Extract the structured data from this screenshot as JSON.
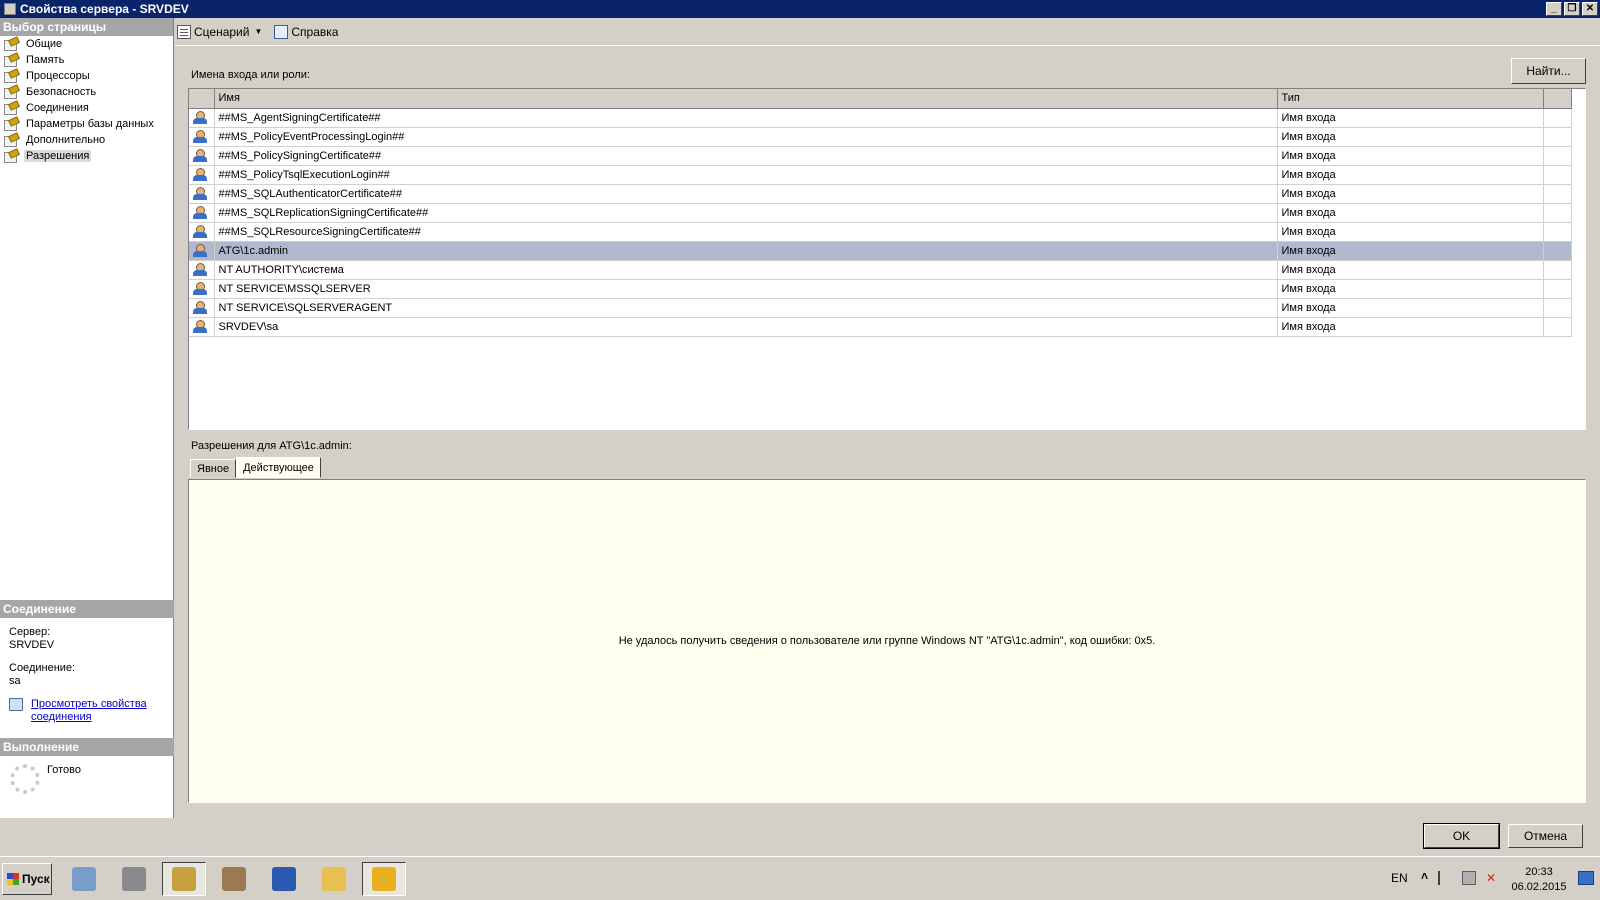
{
  "window": {
    "title": "Свойства сервера - SRVDEV"
  },
  "left_panel": {
    "pages_header": "Выбор страницы",
    "pages": [
      {
        "label": "Общие"
      },
      {
        "label": "Память"
      },
      {
        "label": "Процессоры"
      },
      {
        "label": "Безопасность"
      },
      {
        "label": "Соединения"
      },
      {
        "label": "Параметры базы данных"
      },
      {
        "label": "Дополнительно"
      },
      {
        "label": "Разрешения",
        "active": true
      }
    ],
    "connection_header": "Соединение",
    "server_label": "Сервер:",
    "server_value": "SRVDEV",
    "connection_label": "Соединение:",
    "connection_value": "sa",
    "view_conn_props_link": "Просмотреть свойства соединения",
    "execution_header": "Выполнение",
    "execution_status": "Готово"
  },
  "toolbar": {
    "script_label": "Сценарий",
    "help_label": "Справка"
  },
  "main": {
    "logins_label": "Имена входа или роли:",
    "find_button": "Найти...",
    "columns": {
      "name": "Имя",
      "type": "Тип"
    },
    "rows": [
      {
        "name": "##MS_AgentSigningCertificate##",
        "type": "Имя входа"
      },
      {
        "name": "##MS_PolicyEventProcessingLogin##",
        "type": "Имя входа"
      },
      {
        "name": "##MS_PolicySigningCertificate##",
        "type": "Имя входа"
      },
      {
        "name": "##MS_PolicyTsqlExecutionLogin##",
        "type": "Имя входа"
      },
      {
        "name": "##MS_SQLAuthenticatorCertificate##",
        "type": "Имя входа"
      },
      {
        "name": "##MS_SQLReplicationSigningCertificate##",
        "type": "Имя входа"
      },
      {
        "name": "##MS_SQLResourceSigningCertificate##",
        "type": "Имя входа"
      },
      {
        "name": "ATG\\1c.admin",
        "type": "Имя входа",
        "selected": true
      },
      {
        "name": "NT AUTHORITY\\система",
        "type": "Имя входа"
      },
      {
        "name": "NT SERVICE\\MSSQLSERVER",
        "type": "Имя входа"
      },
      {
        "name": "NT SERVICE\\SQLSERVERAGENT",
        "type": "Имя входа"
      },
      {
        "name": "SRVDEV\\sa",
        "type": "Имя входа"
      }
    ],
    "permissions_label": "Разрешения для ATG\\1c.admin:",
    "tabs": [
      {
        "label": "Явное"
      },
      {
        "label": "Действующее",
        "active": true
      }
    ],
    "error_message": "Не удалось получить сведения о пользователе или группе Windows NT \"ATG\\1c.admin\", код ошибки: 0x5."
  },
  "buttons": {
    "ok": "OK",
    "cancel": "Отмена"
  },
  "taskbar": {
    "start_label": "Пуск",
    "apps": [
      {
        "icon": "calculator-icon",
        "color": "#7a9cc8"
      },
      {
        "icon": "server-manager-icon",
        "color": "#8a8a8a"
      },
      {
        "icon": "sql-management-studio-icon",
        "color": "#c8a040",
        "pressed": true
      },
      {
        "icon": "tools-icon",
        "color": "#9a7a50"
      },
      {
        "icon": "powershell-icon",
        "color": "#2a5ab0"
      },
      {
        "icon": "explorer-icon",
        "color": "#e8c050"
      },
      {
        "icon": "1c-icon",
        "color": "#e8b020",
        "pressed": true
      }
    ],
    "lang": "EN",
    "time": "20:33",
    "date": "06.02.2015"
  }
}
